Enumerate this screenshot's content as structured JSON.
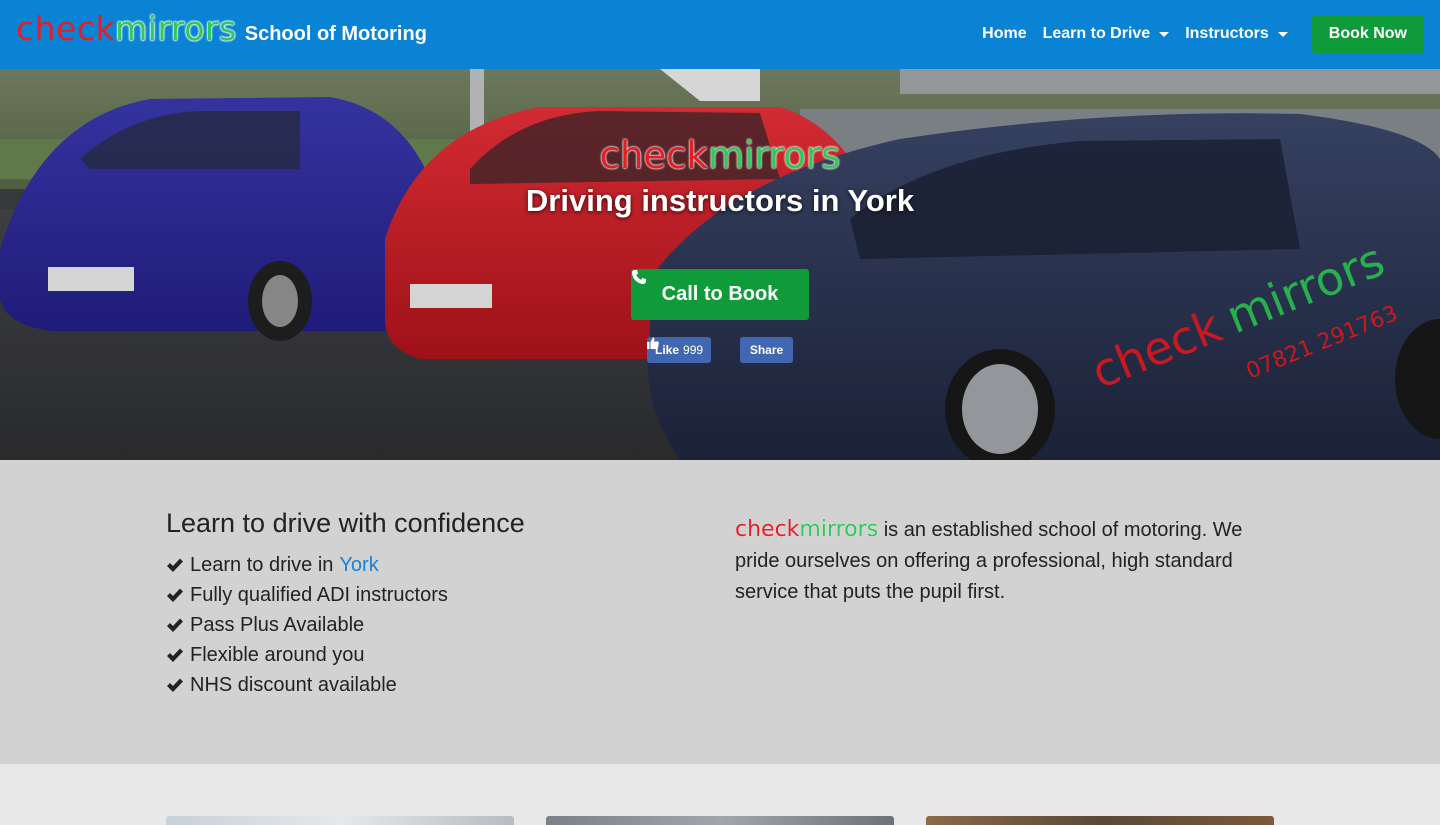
{
  "brand": {
    "logo_check": "check",
    "logo_mirrors": "mirrors",
    "subtitle": "School of Motoring"
  },
  "nav": {
    "home": "Home",
    "learn": "Learn to Drive",
    "instructors": "Instructors",
    "book": "Book Now"
  },
  "hero": {
    "logo_check": "check",
    "logo_mirrors": "mirrors",
    "title": "Driving instructors in York",
    "call_button": "Call to Book",
    "fb_like": "Like",
    "fb_like_count": "999",
    "fb_share": "Share"
  },
  "info": {
    "heading": "Learn to drive with confidence",
    "feature_1_prefix": "Learn to drive in",
    "feature_1_link": "York",
    "features": [
      "Fully qualified ADI instructors",
      "Pass Plus Available",
      "Flexible around you",
      "NHS discount available"
    ],
    "about_logo_check": "check",
    "about_logo_mirrors": "mirrors",
    "about_text": " is an established school of motoring. We pride ourselves on offering a professional, high standard service that puts the pupil first."
  },
  "colors": {
    "navbar": "#0a83d4",
    "green_button": "#109b3a",
    "logo_red": "#e51d25",
    "logo_green": "#2ec95a",
    "link_blue": "#1d7fd1",
    "facebook": "#4267b2"
  }
}
